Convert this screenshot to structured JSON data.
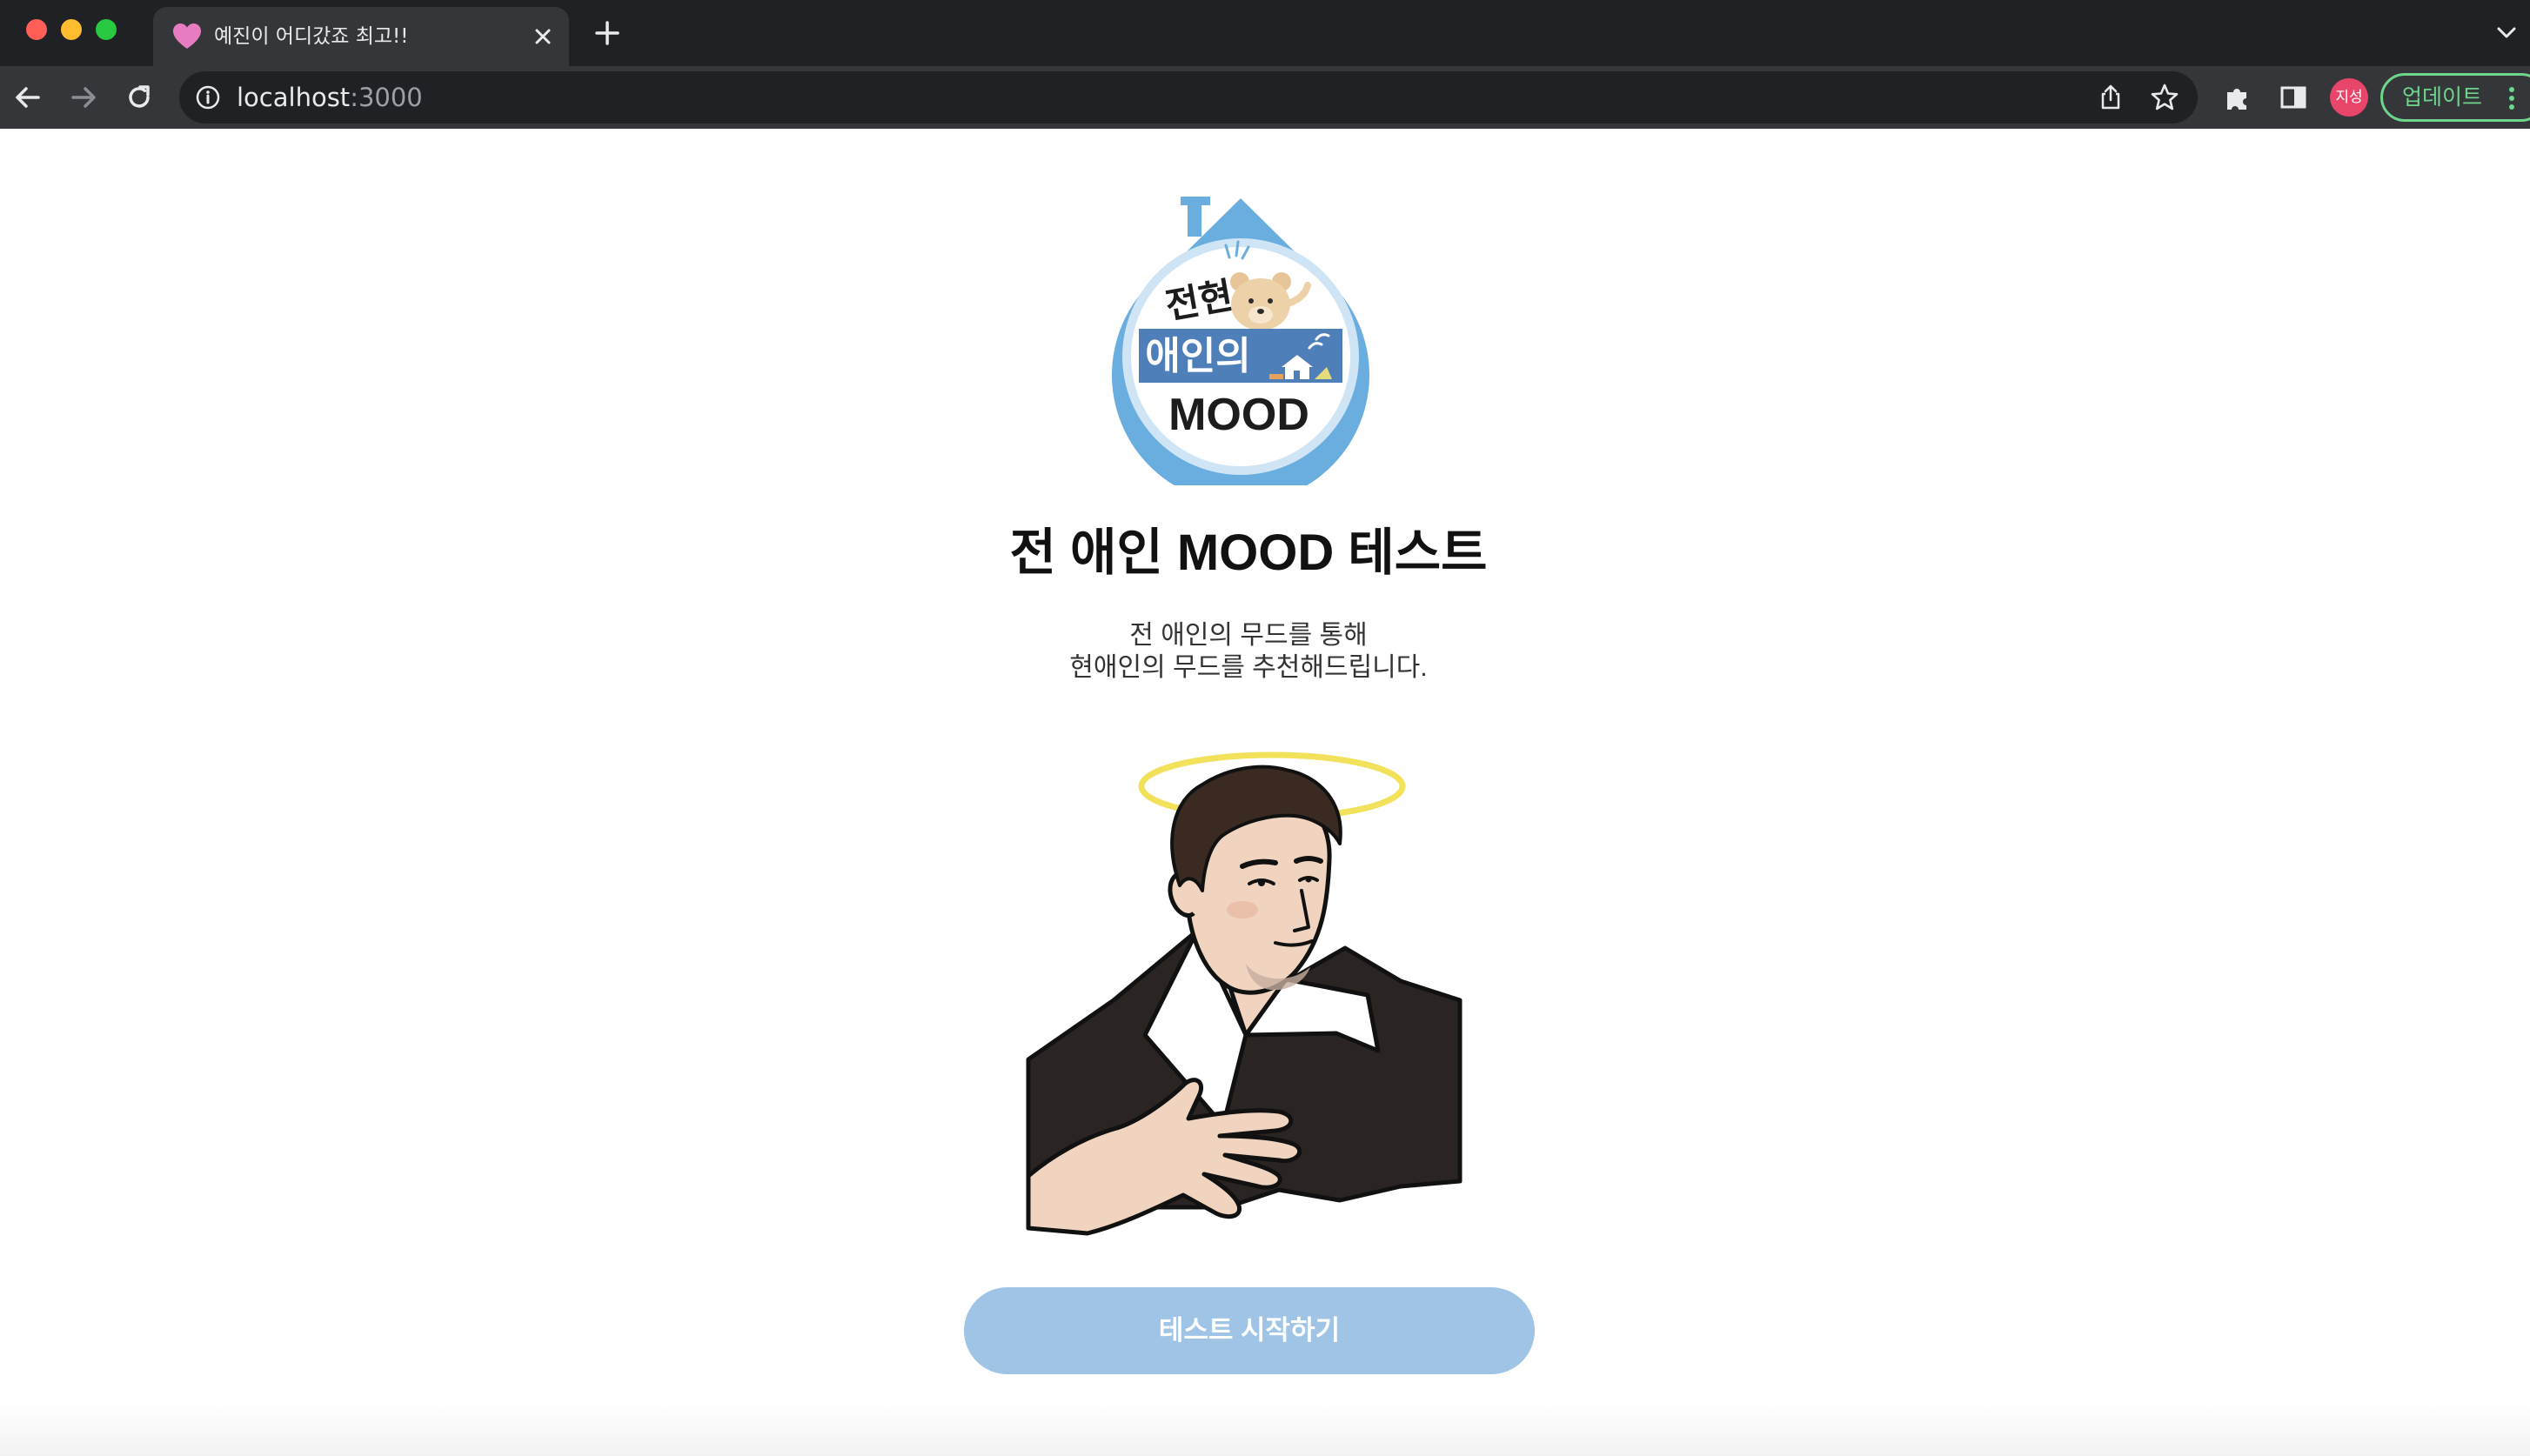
{
  "browser": {
    "tab": {
      "title": "예진이 어디갔죠 최고!!",
      "favicon": "heart-icon"
    },
    "address": {
      "host": "localhost",
      "port": ":3000"
    },
    "profile_initial": "지성",
    "update_label": "업데이트"
  },
  "main": {
    "logo": {
      "line1": "전현",
      "line2": "애인의",
      "line3": "MOOD"
    },
    "title": "전 애인 MOOD 테스트",
    "description_line1": "전 애인의 무드를 통해",
    "description_line2": "현애인의 무드를 추천해드립니다.",
    "start_button": "테스트 시작하기"
  },
  "colors": {
    "accent": "#9fc4e6",
    "logo_blue": "#6aaee0",
    "logo_banner": "#4f7fb8",
    "halo": "#f2e15a"
  }
}
